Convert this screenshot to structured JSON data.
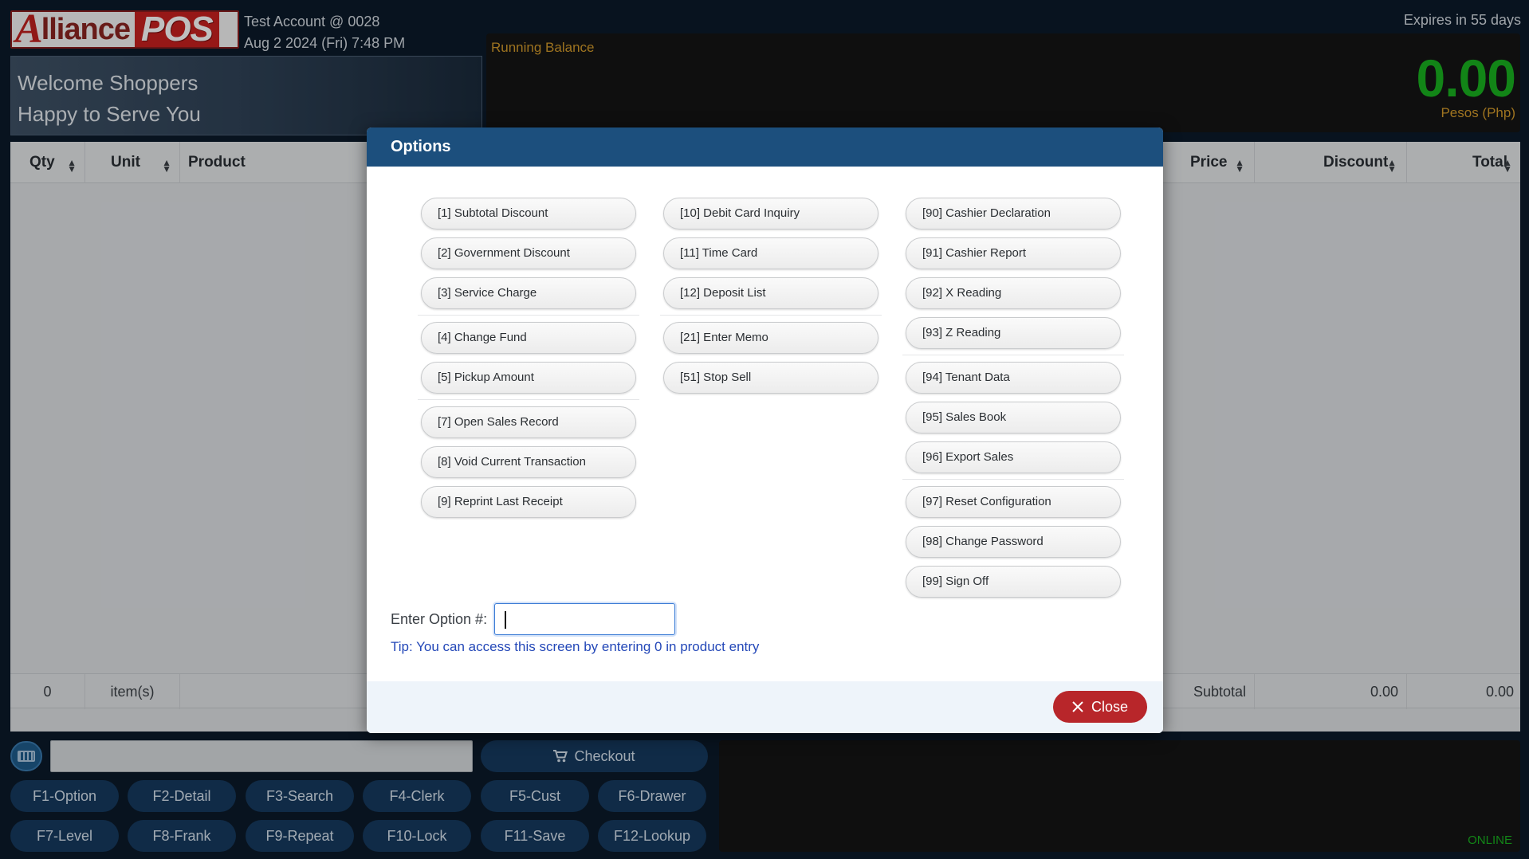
{
  "header": {
    "logo_text": "AlliancePOS",
    "account": "Test Account @ 0028",
    "datetime": "Aug 2 2024 (Fri) 7:48 PM",
    "expires": "Expires in 55 days",
    "welcome_line1": "Welcome Shoppers",
    "welcome_line2": "Happy to Serve You"
  },
  "balance": {
    "label": "Running Balance",
    "amount": "0.00",
    "currency": "Pesos (Php)"
  },
  "table": {
    "columns": [
      "Qty",
      "Unit",
      "Product",
      "Price",
      "Discount",
      "Total"
    ],
    "footer": {
      "count": "0",
      "items_label": "item(s)",
      "subtotal_label": "Subtotal",
      "discount_total": "0.00",
      "total": "0.00"
    }
  },
  "controls": {
    "checkout_label": "Checkout",
    "fkeys": [
      "F1-Option",
      "F2-Detail",
      "F3-Search",
      "F4-Clerk",
      "F5-Cust",
      "F6-Drawer",
      "F7-Level",
      "F8-Frank",
      "F9-Repeat",
      "F10-Lock",
      "F11-Save",
      "F12-Lookup"
    ],
    "status": "ONLINE"
  },
  "modal": {
    "title": "Options",
    "col1": [
      "[1] Subtotal Discount",
      "[2] Government Discount",
      "[3] Service Charge",
      "[4] Change Fund",
      "[5] Pickup Amount",
      "[7] Open Sales Record",
      "[8] Void Current Transaction",
      "[9] Reprint Last Receipt"
    ],
    "col2": [
      "[10] Debit Card Inquiry",
      "[11] Time Card",
      "[12] Deposit List",
      "[21] Enter Memo",
      "[51] Stop Sell"
    ],
    "col3": [
      "[90] Cashier Declaration",
      "[91] Cashier Report",
      "[92] X Reading",
      "[93] Z Reading",
      "[94] Tenant Data",
      "[95] Sales Book",
      "[96] Export Sales",
      "[97] Reset Configuration",
      "[98] Change Password",
      "[99] Sign Off"
    ],
    "enter_label": "Enter Option #:",
    "tip": "Tip: You can access this screen by entering 0 in product entry",
    "close_label": "Close"
  }
}
